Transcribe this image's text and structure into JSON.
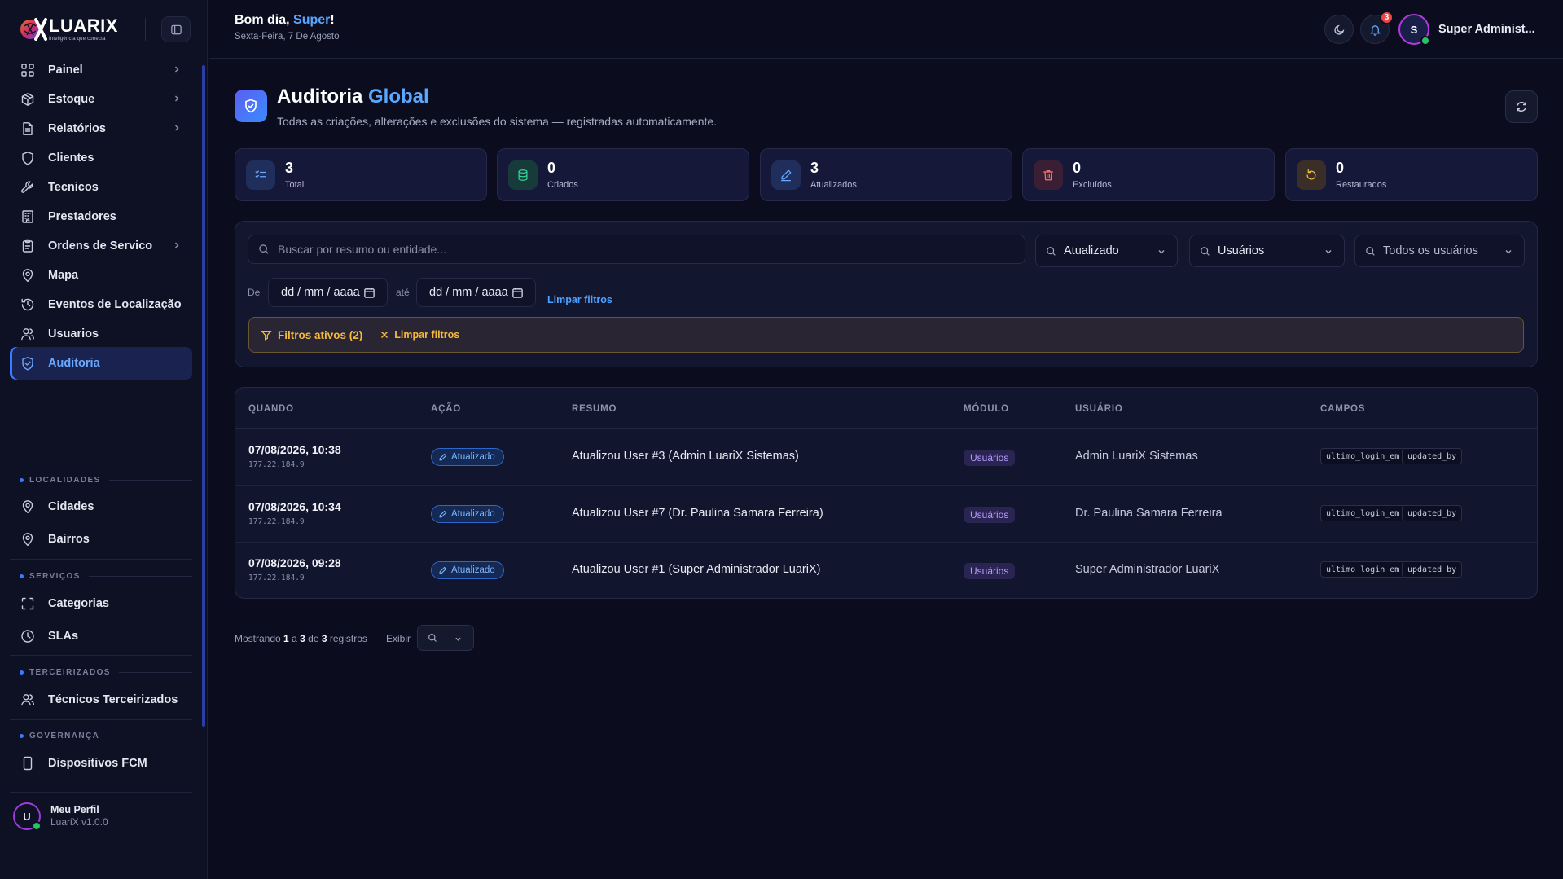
{
  "brand": {
    "name": "LUARIX",
    "tagline": "Inteligência que conecta"
  },
  "header": {
    "greeting_prefix": "Bom dia, ",
    "greeting_name": "Super",
    "greeting_suffix": "!",
    "date": "Sexta-Feira, 7 De Agosto",
    "notification_count": "3",
    "user_initial": "S",
    "user_name": "Super Administ..."
  },
  "sidebar": {
    "items": [
      {
        "label": "Painel",
        "icon": "grid-icon",
        "has_children": true
      },
      {
        "label": "Estoque",
        "icon": "package-icon",
        "has_children": true
      },
      {
        "label": "Relatórios",
        "icon": "file-text-icon",
        "has_children": true
      },
      {
        "label": "Clientes",
        "icon": "shield-icon",
        "has_children": false
      },
      {
        "label": "Tecnicos",
        "icon": "wrench-icon",
        "has_children": false
      },
      {
        "label": "Prestadores",
        "icon": "building-icon",
        "has_children": false
      },
      {
        "label": "Ordens de Servico",
        "icon": "clipboard-icon",
        "has_children": true
      },
      {
        "label": "Mapa",
        "icon": "map-pin-icon",
        "has_children": false
      },
      {
        "label": "Eventos de Localização",
        "icon": "history-icon",
        "has_children": false
      },
      {
        "label": "Usuarios",
        "icon": "users-icon",
        "has_children": false
      },
      {
        "label": "Auditoria",
        "icon": "shield-check-icon",
        "has_children": false,
        "active": true
      }
    ],
    "sections": [
      {
        "label": "LOCALIDADES",
        "items": [
          {
            "label": "Cidades",
            "icon": "map-pin-icon"
          },
          {
            "label": "Bairros",
            "icon": "map-pin-icon"
          }
        ]
      },
      {
        "label": "SERVIÇOS",
        "items": [
          {
            "label": "Categorias",
            "icon": "scan-icon"
          },
          {
            "label": "SLAs",
            "icon": "clock-icon"
          }
        ]
      },
      {
        "label": "TERCEIRIZADOS",
        "items": [
          {
            "label": "Técnicos Terceirizados",
            "icon": "users-icon"
          }
        ]
      },
      {
        "label": "GOVERNANÇA",
        "items": [
          {
            "label": "Dispositivos FCM",
            "icon": "smartphone-icon"
          }
        ]
      }
    ],
    "profile": {
      "initial": "U",
      "name": "Meu Perfil",
      "version": "LuariX v1.0.0"
    }
  },
  "page": {
    "title_main": "Auditoria ",
    "title_highlight": "Global",
    "subtitle": "Todas as criações, alterações e exclusões do sistema — registradas automaticamente."
  },
  "stats": [
    {
      "value": "3",
      "label": "Total",
      "color": "#6aa8ff",
      "bg": "#1f2e5a",
      "icon": "list-check-icon"
    },
    {
      "value": "0",
      "label": "Criados",
      "color": "#34d399",
      "bg": "#173a3a",
      "icon": "database-icon"
    },
    {
      "value": "3",
      "label": "Atualizados",
      "color": "#6aa8ff",
      "bg": "#1f2e5a",
      "icon": "pencil-icon"
    },
    {
      "value": "0",
      "label": "Excluídos",
      "color": "#f87171",
      "bg": "#3a1f34",
      "icon": "trash-icon"
    },
    {
      "value": "0",
      "label": "Restaurados",
      "color": "#f5b93b",
      "bg": "#3a2f28",
      "icon": "rotate-icon"
    }
  ],
  "filters": {
    "search_placeholder": "Buscar por resumo ou entidade...",
    "action_select": "Atualizado",
    "module_select": "Usuários",
    "user_select": "Todos os usuários",
    "from_label": "De",
    "to_label": "até",
    "date_placeholder": "dd / mm / aaaa",
    "clear_link": "Limpar filtros",
    "active_label": "Filtros ativos (2)",
    "active_clear": "Limpar filtros"
  },
  "table": {
    "headers": [
      "QUANDO",
      "AÇÃO",
      "RESUMO",
      "MÓDULO",
      "USUÁRIO",
      "CAMPOS"
    ],
    "rows": [
      {
        "when": "07/08/2026, 10:38",
        "ip": "177.22.184.9",
        "action": "Atualizado",
        "summary": "Atualizou User #3 (Admin LuariX Sistemas)",
        "module": "Usuários",
        "user": "Admin LuariX Sistemas",
        "fields": [
          "ultimo_login_em",
          "updated_by"
        ]
      },
      {
        "when": "07/08/2026, 10:34",
        "ip": "177.22.184.9",
        "action": "Atualizado",
        "summary": "Atualizou User #7 (Dr. Paulina Samara Ferreira)",
        "module": "Usuários",
        "user": "Dr. Paulina Samara Ferreira",
        "fields": [
          "ultimo_login_em",
          "updated_by"
        ]
      },
      {
        "when": "07/08/2026, 09:28",
        "ip": "177.22.184.9",
        "action": "Atualizado",
        "summary": "Atualizou User #1 (Super Administrador LuariX)",
        "module": "Usuários",
        "user": "Super Administrador LuariX",
        "fields": [
          "ultimo_login_em",
          "updated_by"
        ]
      }
    ]
  },
  "pagination": {
    "showing": "Mostrando",
    "from": "1",
    "sep_a": "a",
    "to": "3",
    "sep_de": "de",
    "total": "3",
    "suffix": "registros",
    "per_page_label": "Exibir"
  }
}
